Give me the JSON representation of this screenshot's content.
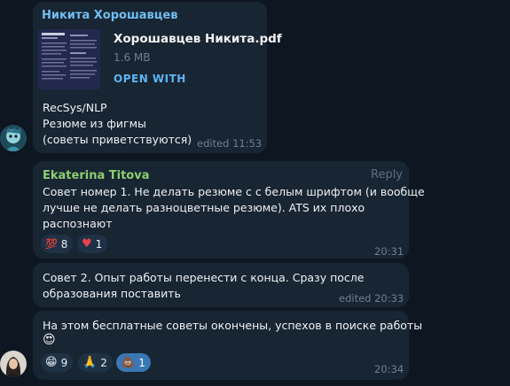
{
  "messages": {
    "m1": {
      "sender": "Никита Хорошавцев",
      "file_name": "Хорошавцев Никита.pdf",
      "file_size": "1.6 MB",
      "open_with": "OPEN WITH",
      "lines": [
        "RecSys/NLP",
        "Резюме из фигмы",
        "(советы приветствуются)"
      ],
      "time": "edited 11:53"
    },
    "m2": {
      "sender": "Ekaterina Titova",
      "reply": "Reply",
      "lines": [
        "Совет номер 1. Не делать резюме с с белым шрифтом (и вообще",
        "лучше не делать разноцветные резюме). ATS их плохо",
        "распознают"
      ],
      "reactions": [
        {
          "emoji": "💯",
          "count": "8"
        },
        {
          "emoji": "♥",
          "count": "1"
        }
      ],
      "time": "20:31"
    },
    "m3": {
      "lines": [
        "Совет 2. Опыт работы перенести с конца. Сразу после",
        "образования поставить"
      ],
      "time": "edited 20:33"
    },
    "m4": {
      "lines": [
        "На этом бесплатные советы окончены, успехов в поиске работы"
      ],
      "emoji": "😍",
      "reactions": [
        {
          "emoji": "😁",
          "count": "9"
        },
        {
          "emoji": "🙏",
          "count": "2"
        },
        {
          "emoji": "💩",
          "count": "1"
        }
      ],
      "time": "20:34"
    }
  },
  "colors": {
    "sender1": "#72bdf0",
    "sender2": "#8ccf6e",
    "accent": "#5eb5f7",
    "heart": "#e8424d"
  }
}
